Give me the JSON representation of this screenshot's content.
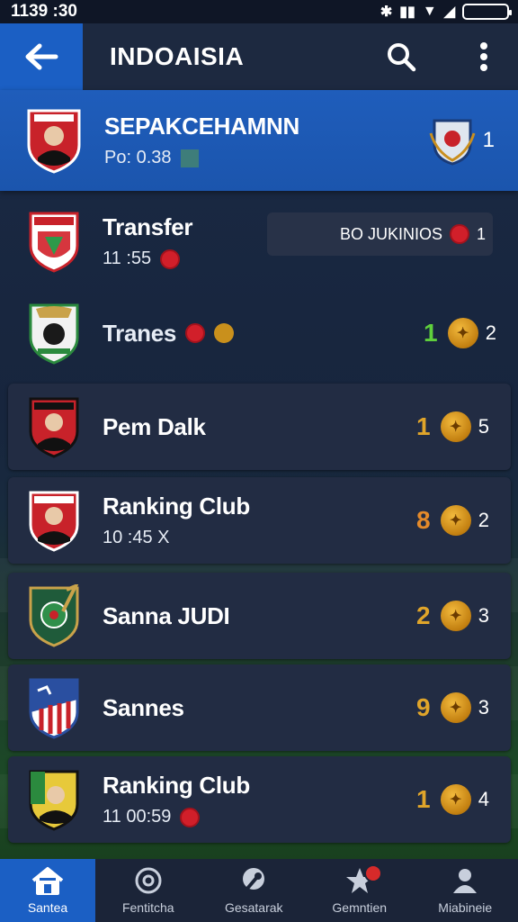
{
  "status_bar": {
    "time": "1139 :30"
  },
  "app_bar": {
    "title": "INDOAISIA"
  },
  "featured": {
    "name": "SEPAKCEHAMNN",
    "sub": "Po: 0.38",
    "rank": "1"
  },
  "transfer_pill": {
    "label": "BO JUKINIOS",
    "count": "1"
  },
  "rows": [
    {
      "name": "Transfer",
      "sub": "11 :55",
      "num": "",
      "rank": ""
    },
    {
      "name": "Tranes",
      "sub": "",
      "num": "1",
      "rank": "2"
    },
    {
      "name": "Pem Dalk",
      "sub": "",
      "num": "1",
      "rank": "5"
    },
    {
      "name": "Ranking Club",
      "sub": "10 :45 X",
      "num": "8",
      "rank": "2"
    },
    {
      "name": "Sanna JUDI",
      "sub": "",
      "num": "2",
      "rank": "3"
    },
    {
      "name": "Sannes",
      "sub": "",
      "num": "9",
      "rank": "3"
    },
    {
      "name": "Ranking Club",
      "sub": "11 00:59",
      "num": "1",
      "rank": "4"
    }
  ],
  "bottom_nav": [
    {
      "label": "Santea",
      "icon": "home-icon"
    },
    {
      "label": "Fentitcha",
      "icon": "fixture-icon"
    },
    {
      "label": "Gesatarak",
      "icon": "tools-icon"
    },
    {
      "label": "Gemntien",
      "icon": "star-icon"
    },
    {
      "label": "Miabineie",
      "icon": "profile-icon"
    }
  ],
  "colors": {
    "accent": "#1b5fc4",
    "card": "#222c43",
    "gold": "#e0a52a",
    "green": "#5fcf3c"
  }
}
